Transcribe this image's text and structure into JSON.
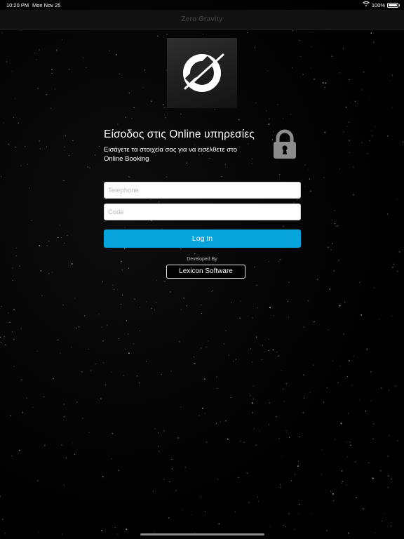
{
  "status_bar": {
    "time": "10:20 PM",
    "date": "Mon Nov 25",
    "battery": "100%",
    "wifi_icon": "wifi-icon",
    "battery_icon": "battery-full-icon"
  },
  "nav": {
    "title": "Zero Gravity"
  },
  "logo": {
    "icon": "zero-gravity-logo-icon"
  },
  "login": {
    "title": "Είσοδος στις Online υπηρεσίες",
    "subtitle": "Εισάγετε τα στοιχεία σας για να εισέλθετε στο Online Booking",
    "lock_icon": "lock-icon",
    "telephone_placeholder": "Telephone",
    "telephone_value": "",
    "code_placeholder": "Code",
    "code_value": "",
    "login_button": "Log In"
  },
  "footer": {
    "developed_by": "Developed By",
    "developer_button": "Lexicon Software"
  },
  "colors": {
    "background": "#000000",
    "accent": "#08a5dc",
    "text": "#ffffff"
  }
}
